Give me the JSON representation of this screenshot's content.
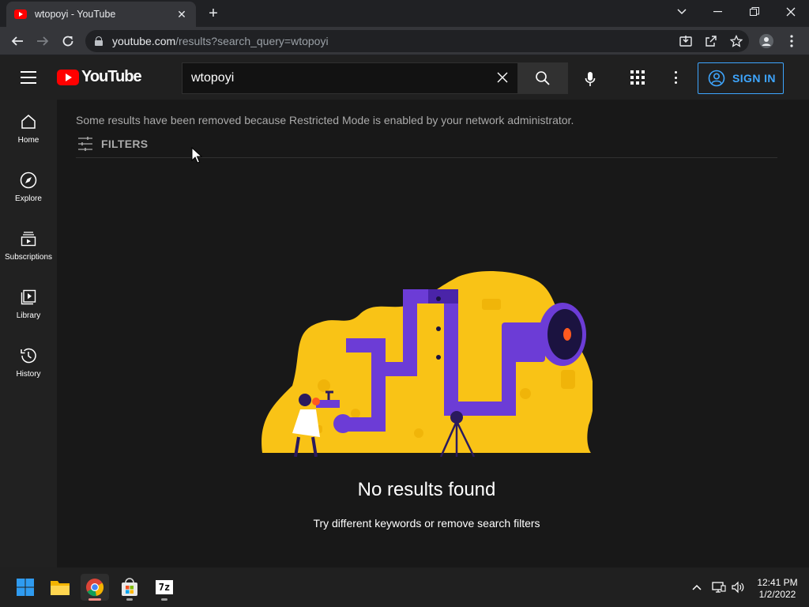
{
  "browser": {
    "tab_title": "wtopoyi - YouTube",
    "tab_close": "✕",
    "new_tab": "+",
    "url_host": "youtube.com",
    "url_path": "/results?search_query=wtopoyi",
    "window_controls": [
      "chevron-down-icon",
      "minimize-icon",
      "restore-icon",
      "close-icon"
    ]
  },
  "masthead": {
    "logo_text": "YouTube",
    "search_value": "wtopoyi",
    "signin_label": "SIGN IN",
    "accent_color": "#3ea6ff",
    "brand_color": "#ff0000"
  },
  "sidebar": {
    "items": [
      {
        "label": "Home",
        "icon": "home-icon"
      },
      {
        "label": "Explore",
        "icon": "compass-icon"
      },
      {
        "label": "Subscriptions",
        "icon": "subscriptions-icon"
      },
      {
        "label": "Library",
        "icon": "library-icon"
      },
      {
        "label": "History",
        "icon": "history-icon"
      }
    ]
  },
  "main": {
    "notice": "Some results have been removed because Restricted Mode is enabled by your network administrator.",
    "filters_label": "FILTERS",
    "no_results_title": "No results found",
    "no_results_subtitle": "Try different keywords or remove search filters"
  },
  "taskbar": {
    "apps": [
      "windows-start-icon",
      "file-explorer-icon",
      "chrome-icon",
      "microsoft-store-icon",
      "7zip-icon"
    ],
    "zip_label": "7z",
    "time": "12:41 PM",
    "date": "1/2/2022"
  }
}
